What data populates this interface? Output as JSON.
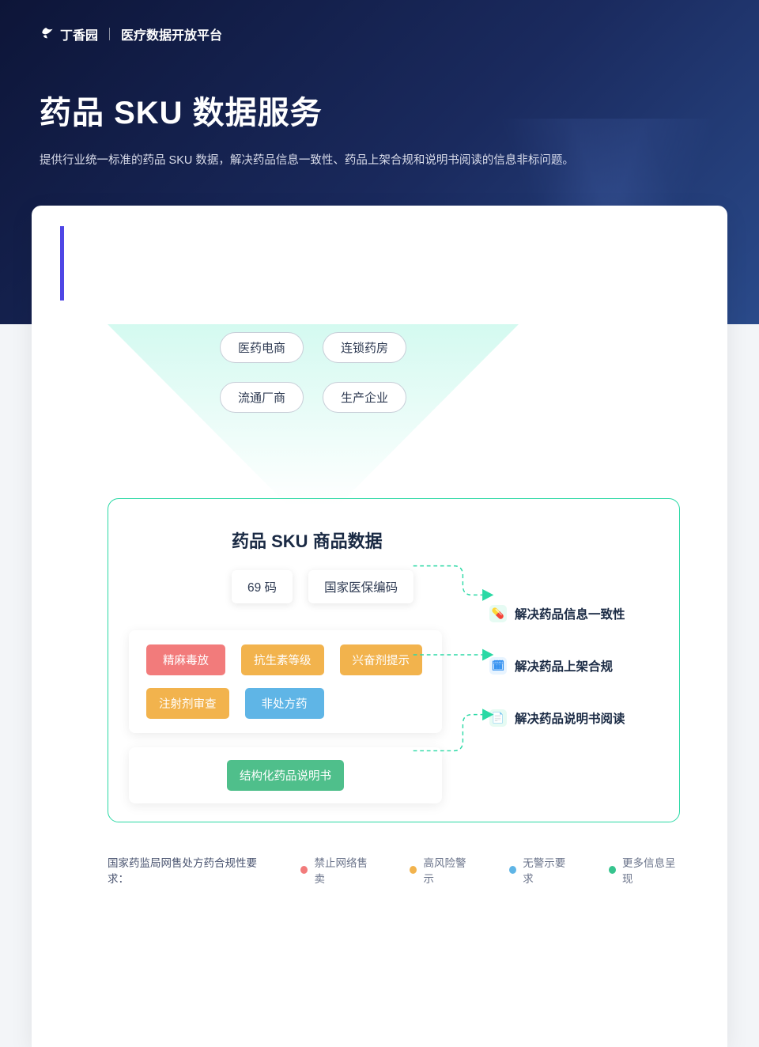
{
  "brand": {
    "name": "丁香园",
    "platform": "医疗数据开放平台"
  },
  "hero": {
    "title": "药品 SKU 数据服务",
    "subtitle": "提供行业统一标准的药品 SKU 数据，解决药品信息一致性、药品上架合规和说明书阅读的信息非标问题。"
  },
  "top_entities": {
    "row1": [
      "医药电商",
      "连锁药房"
    ],
    "row2": [
      "流通厂商",
      "生产企业"
    ]
  },
  "green_zone": {
    "title": "药品 SKU 商品数据",
    "codes": [
      "69 码",
      "国家医保编码"
    ],
    "chips_row1": [
      {
        "label": "精麻毒放",
        "color": "c-red"
      },
      {
        "label": "抗生素等级",
        "color": "c-orange"
      },
      {
        "label": "兴奋剂提示",
        "color": "c-orange"
      }
    ],
    "chips_row2": [
      {
        "label": "注射剂审查",
        "color": "c-orange"
      },
      {
        "label": "非处方药",
        "color": "c-blue"
      }
    ],
    "chip_block2": {
      "label": "结构化药品说明书",
      "color": "c-green"
    }
  },
  "benefits": [
    {
      "icon_bg": "#e6fbf3",
      "icon_color": "#22c08a",
      "glyph": "💊",
      "text": "解决药品信息一致性"
    },
    {
      "icon_bg": "#e8f4ff",
      "icon_color": "#2f8ef0",
      "glyph": "🗓",
      "text": "解决药品上架合规"
    },
    {
      "icon_bg": "#e6fbf3",
      "icon_color": "#22c08a",
      "glyph": "📄",
      "text": "解决药品说明书阅读"
    }
  ],
  "legend": {
    "title": "国家药监局网售处方药合规性要求：",
    "items": [
      {
        "color": "#f27b7b",
        "label": "禁止网络售卖"
      },
      {
        "color": "#f2b34d",
        "label": "高风险警示"
      },
      {
        "color": "#5fb5e6",
        "label": "无警示要求"
      },
      {
        "color": "#36c48e",
        "label": "更多信息呈现"
      }
    ]
  }
}
